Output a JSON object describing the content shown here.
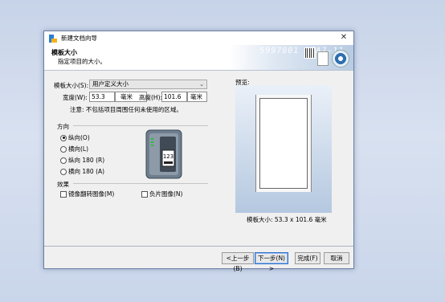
{
  "window": {
    "title": "新建文档向导"
  },
  "header": {
    "title": "模板大小",
    "subtitle": "指定项目的大小。",
    "banner_text": "5997001  1EA7-11"
  },
  "form": {
    "template_size_label": "模板大小(S):",
    "template_size_value": "用户定义大小",
    "width_label": "宽度(W):",
    "width_value": "53.3",
    "width_unit": "毫米",
    "height_label": "高度(H):",
    "height_value": "101.6",
    "height_unit": "毫米",
    "note": "注意: 不包括项目周围任何未使用的区域。"
  },
  "orientation": {
    "label": "方向",
    "options": [
      {
        "label": "纵向(O)",
        "selected": true
      },
      {
        "label": "横向(L)",
        "selected": false
      },
      {
        "label": "纵向 180 (R)",
        "selected": false
      },
      {
        "label": "横向 180 (A)",
        "selected": false
      }
    ]
  },
  "printer_illustration": {
    "sample_text": "123"
  },
  "effects": {
    "label": "效果",
    "mirror_label": "镜像翻转图像(M)",
    "negative_label": "负片图像(N)"
  },
  "preview": {
    "label": "预览:",
    "size_text": "模板大小: 53.3 x 101.6 毫米"
  },
  "buttons": {
    "back": "<上一步(B)",
    "next": "下一步(N) >",
    "finish": "完成(F)",
    "cancel": "取消"
  },
  "colors": {
    "accent": "#2f6fc9",
    "background": "#d8e1f0"
  }
}
